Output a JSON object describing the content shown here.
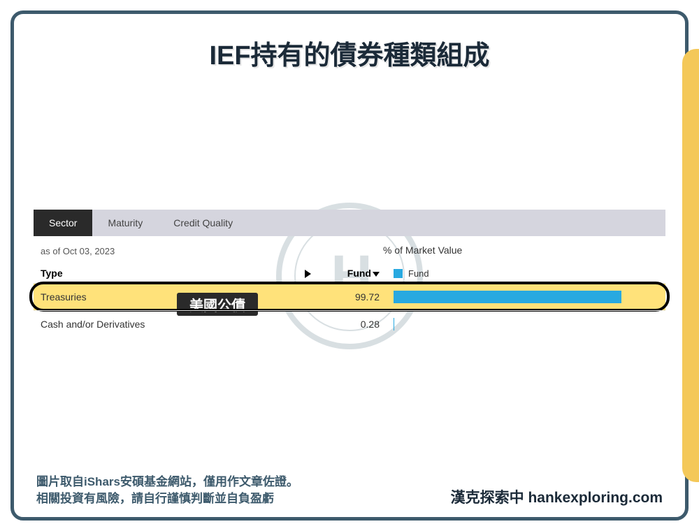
{
  "title": "IEF持有的債券種類組成",
  "watermark_text": "H",
  "tabs": [
    {
      "label": "Sector",
      "active": true
    },
    {
      "label": "Maturity",
      "active": false
    },
    {
      "label": "Credit Quality",
      "active": false
    }
  ],
  "as_of": "as of Oct 03, 2023",
  "chart_title": "% of Market Value",
  "columns": {
    "type": "Type",
    "fund": "Fund"
  },
  "legend": {
    "label": "Fund",
    "color": "#28a9e0"
  },
  "annotation_badge": "美國公債",
  "footer": {
    "line1": "圖片取自iShars安碩基金網站，僅用作文章佐證。",
    "line2": "相關投資有風險，請自行謹慎判斷並自負盈虧",
    "brand": "漢克探索中 hankexploring.com"
  },
  "chart_data": {
    "type": "bar",
    "orientation": "horizontal",
    "title": "% of Market Value",
    "xlabel": "",
    "ylabel": "",
    "xlim": [
      0,
      100
    ],
    "categories": [
      "Treasuries",
      "Cash and/or Derivatives"
    ],
    "series": [
      {
        "name": "Fund",
        "color": "#28a9e0",
        "values": [
          99.72,
          0.28
        ]
      }
    ]
  }
}
